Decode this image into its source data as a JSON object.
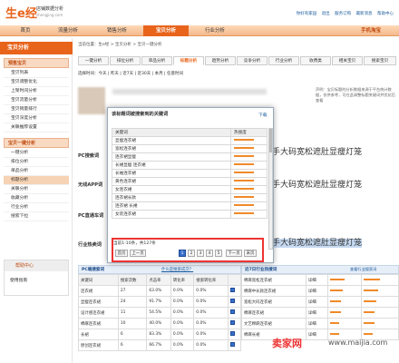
{
  "header": {
    "logo": "生e经",
    "logo_sub": "店铺数据分析",
    "logo_url": "shengjing.com",
    "links": [
      "你好有家园",
      "退出",
      "服务订购",
      "最新消息",
      "帮助中心"
    ]
  },
  "nav": {
    "tabs": [
      "首页",
      "流量分析",
      "销售分析",
      "宝贝分析",
      "行业分析"
    ],
    "right": "手机淘宝"
  },
  "sidebar": {
    "title": "宝贝分析",
    "cat1": "预售宝贝",
    "items1": [
      "宝贝列表",
      "宝贝调整优化",
      "上架时间分析",
      "宝贝流量分析",
      "宝贝销量排行",
      "宝贝深度分析",
      "关联推荐设置"
    ],
    "cat2": "宝贝一键分析",
    "items2": [
      "一键分析",
      "排位分析",
      "单品分析",
      "标题分析",
      "关联分析",
      "收藏分析",
      "行业分析",
      "搜索下拉"
    ],
    "help_title": "帮助中心",
    "help_item": "使用指南"
  },
  "breadcrumb": "当前位置：生e经 > 宝贝分析 > 宝贝一键分析",
  "subtabs": [
    "一键分析",
    "排位分析",
    "单品分析",
    "标题分析",
    "趋势分析",
    "竞争分析",
    "行业分析",
    "收费类",
    "相关宝贝",
    "搜索宝贝"
  ],
  "time_row": "选择时间：今天 | 昨天 | 近7天 | 近30天 | 本月 | 任意时间",
  "promo": "声明：宝贝标题的分析数据来源于平台统计数据，仅供参考，可在此调整标题关键词并优化后查看",
  "labels": [
    "PC搜索词",
    "无线APP词",
    "PC直通车词",
    "行业热卖词"
  ],
  "big_keywords": [
    "手大码宽松遮肚显瘦灯笼",
    "手大码宽松遮肚显瘦灯笼",
    "手大码宽松遮肚显瘦灯笼"
  ],
  "left_table": {
    "title": "PC端搜索词",
    "link": "什么是搜索成交？",
    "headers": [
      "关键词",
      "搜索次数",
      "点击率",
      "转化率",
      "搜索转化率",
      ""
    ],
    "rows": [
      [
        "连衣裙",
        "27",
        "63.0%",
        "0.0%",
        "0.0%"
      ],
      [
        "显瘦连衣裙",
        "24",
        "91.7%",
        "0.0%",
        "0.0%"
      ],
      [
        "设计感连衣裙",
        "11",
        "54.5%",
        "0.0%",
        "0.0%"
      ],
      [
        "棉麻连衣裙",
        "10",
        "40.0%",
        "0.0%",
        "0.0%"
      ],
      [
        "长裙",
        "6",
        "83.3%",
        "0.0%",
        "0.0%"
      ],
      [
        "原创连衣裙",
        "6",
        "66.7%",
        "0.0%",
        "0.0%"
      ],
      [
        "女装",
        "5",
        "40.0%",
        "0.0%",
        "0.0%"
      ]
    ]
  },
  "right_table": {
    "title": "近7日行业热搜词",
    "link": "查看行业搜索词",
    "rows": [
      [
        "棉麻宽松连衣裙",
        "详细"
      ],
      [
        "棉麻中长款连衣裙",
        "详细"
      ],
      [
        "宽松大码连衣裙",
        "详细"
      ],
      [
        "棉麻连衣裙",
        "详细"
      ],
      [
        "文艺棉麻连衣裙",
        "详细"
      ],
      [
        "棉麻长裙",
        "详细"
      ],
      [
        "大码连衣裙",
        "详细"
      ]
    ]
  },
  "modal": {
    "title": "该标题词被搜索到的关键词",
    "close": "下载",
    "headers": [
      "关键词",
      "热搜度"
    ],
    "rows": [
      "显瘦连衣裙",
      "宽松连衣裙",
      "连衣裙显瘦",
      "长裙显瘦 连衣裙",
      "长袖连衣裙",
      "黄色连衣裙",
      "女连衣裙",
      "连衣裙长款",
      "连衣裙 长裙",
      "女装连衣裙"
    ],
    "pager_info": "当前1-10条，共127条",
    "pages": [
      "首页",
      "上一页",
      "1",
      "2",
      "3",
      "4",
      "5",
      "下一页",
      "末页"
    ],
    "current_page": "1"
  },
  "watermark": {
    "text": "卖家网",
    "url": "www.maijia.com"
  }
}
